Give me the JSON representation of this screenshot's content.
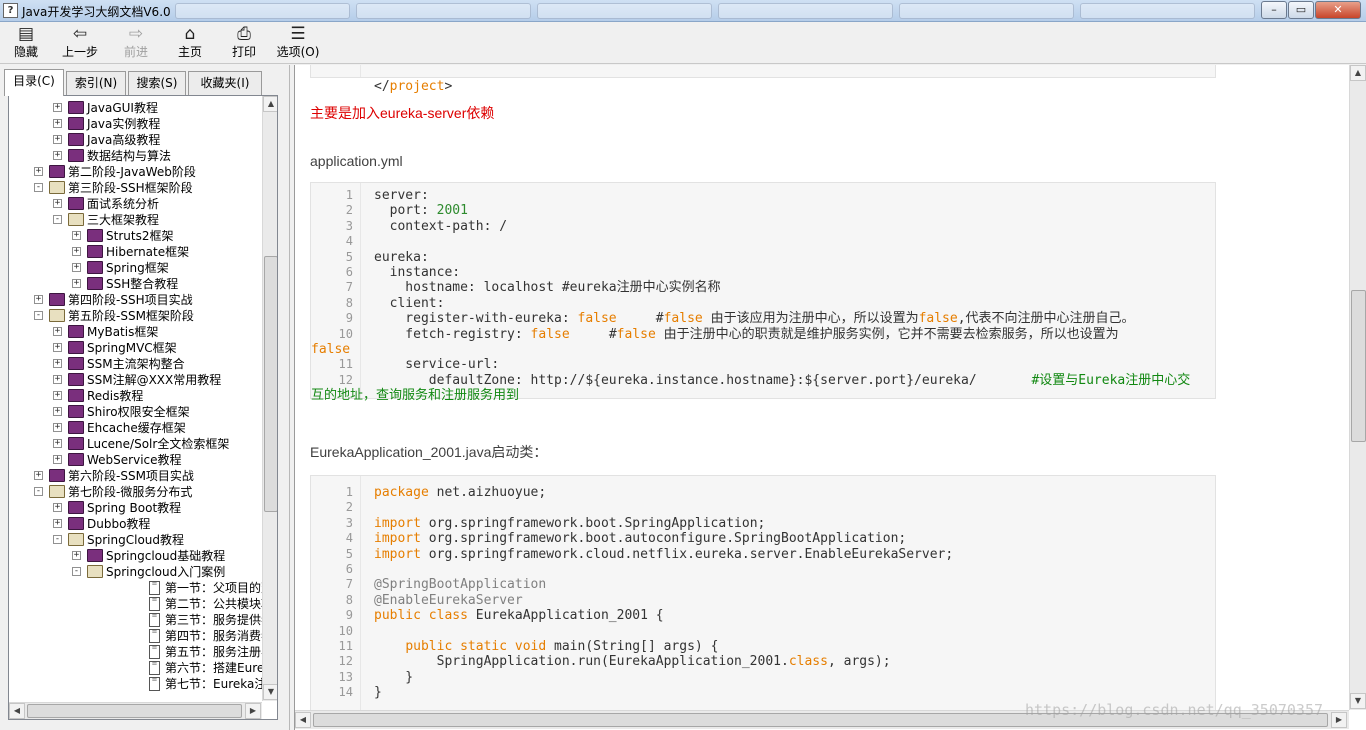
{
  "window": {
    "title": "Java开发学习大纲文档V6.0",
    "icon_char": "?",
    "buttons": [
      "minimize-icon",
      "maximize-icon",
      "close-icon"
    ]
  },
  "toolbar": [
    {
      "id": "hide",
      "label": "隐藏",
      "icon": "hide-icon",
      "glyph": "▤",
      "enabled": true
    },
    {
      "id": "back",
      "label": "上一步",
      "icon": "back-arrow-icon",
      "glyph": "⇦",
      "enabled": true
    },
    {
      "id": "forward",
      "label": "前进",
      "icon": "forward-arrow-icon",
      "glyph": "⇨",
      "enabled": false
    },
    {
      "id": "home",
      "label": "主页",
      "icon": "home-icon",
      "glyph": "⌂",
      "enabled": true
    },
    {
      "id": "print",
      "label": "打印",
      "icon": "printer-icon",
      "glyph": "⎙",
      "enabled": true
    },
    {
      "id": "options",
      "label": "选项(O)",
      "icon": "options-icon",
      "glyph": "☰",
      "enabled": true
    }
  ],
  "tabs": [
    {
      "label": "目录(C)",
      "active": true
    },
    {
      "label": "索引(N)",
      "active": false
    },
    {
      "label": "搜索(S)",
      "active": false
    },
    {
      "label": "收藏夹(I)",
      "active": false
    }
  ],
  "tree": [
    {
      "level": 1,
      "expander": "+",
      "icon": "book",
      "label": "JavaGUI教程"
    },
    {
      "level": 1,
      "expander": "+",
      "icon": "book",
      "label": "Java实例教程"
    },
    {
      "level": 1,
      "expander": "+",
      "icon": "book",
      "label": "Java高级教程"
    },
    {
      "level": 1,
      "expander": "+",
      "icon": "book",
      "label": "数据结构与算法"
    },
    {
      "level": 0,
      "expander": "+",
      "icon": "book",
      "label": "第二阶段-JavaWeb阶段"
    },
    {
      "level": 0,
      "expander": "-",
      "icon": "book-open",
      "label": "第三阶段-SSH框架阶段"
    },
    {
      "level": 1,
      "expander": "+",
      "icon": "book",
      "label": "面试系统分析"
    },
    {
      "level": 1,
      "expander": "-",
      "icon": "book-open",
      "label": "三大框架教程"
    },
    {
      "level": 2,
      "expander": "+",
      "icon": "book",
      "label": "Struts2框架"
    },
    {
      "level": 2,
      "expander": "+",
      "icon": "book",
      "label": "Hibernate框架"
    },
    {
      "level": 2,
      "expander": "+",
      "icon": "book",
      "label": "Spring框架"
    },
    {
      "level": 2,
      "expander": "+",
      "icon": "book",
      "label": "SSH整合教程"
    },
    {
      "level": 0,
      "expander": "+",
      "icon": "book",
      "label": "第四阶段-SSH项目实战"
    },
    {
      "level": 0,
      "expander": "-",
      "icon": "book-open",
      "label": "第五阶段-SSM框架阶段"
    },
    {
      "level": 1,
      "expander": "+",
      "icon": "book",
      "label": "MyBatis框架"
    },
    {
      "level": 1,
      "expander": "+",
      "icon": "book",
      "label": "SpringMVC框架"
    },
    {
      "level": 1,
      "expander": "+",
      "icon": "book",
      "label": "SSM主流架构整合"
    },
    {
      "level": 1,
      "expander": "+",
      "icon": "book",
      "label": "SSM注解@XXX常用教程"
    },
    {
      "level": 1,
      "expander": "+",
      "icon": "book",
      "label": "Redis教程"
    },
    {
      "level": 1,
      "expander": "+",
      "icon": "book",
      "label": "Shiro权限安全框架"
    },
    {
      "level": 1,
      "expander": "+",
      "icon": "book",
      "label": "Ehcache缓存框架"
    },
    {
      "level": 1,
      "expander": "+",
      "icon": "book",
      "label": "Lucene/Solr全文检索框架"
    },
    {
      "level": 1,
      "expander": "+",
      "icon": "book",
      "label": "WebService教程"
    },
    {
      "level": 0,
      "expander": "+",
      "icon": "book",
      "label": "第六阶段-SSM项目实战"
    },
    {
      "level": 0,
      "expander": "-",
      "icon": "book-open",
      "label": "第七阶段-微服务分布式"
    },
    {
      "level": 1,
      "expander": "+",
      "icon": "book",
      "label": "Spring Boot教程"
    },
    {
      "level": 1,
      "expander": "+",
      "icon": "book",
      "label": "Dubbo教程"
    },
    {
      "level": 1,
      "expander": "-",
      "icon": "book-open",
      "label": "SpringCloud教程"
    },
    {
      "level": 2,
      "expander": "+",
      "icon": "book",
      "label": "Springcloud基础教程"
    },
    {
      "level": 2,
      "expander": "-",
      "icon": "book-open",
      "label": "Springcloud入门案例"
    },
    {
      "level": 3,
      "expander": "",
      "icon": "page",
      "label": "第一节：父项目的建立"
    },
    {
      "level": 3,
      "expander": "",
      "icon": "page",
      "label": "第二节：公共模块项目搭建"
    },
    {
      "level": 3,
      "expander": "",
      "icon": "page",
      "label": "第三节：服务提供者项目建立"
    },
    {
      "level": 3,
      "expander": "",
      "icon": "page",
      "label": "第四节：服务消费者项目建立"
    },
    {
      "level": 3,
      "expander": "",
      "icon": "page",
      "label": "第五节：服务注册与发现组件"
    },
    {
      "level": 3,
      "expander": "",
      "icon": "page",
      "label": "第六节：搭建Eureka服务注册"
    },
    {
      "level": 3,
      "expander": "",
      "icon": "page",
      "label": "第七节：Eureka注册服务提供"
    }
  ],
  "content": {
    "top_code_line": "</project>",
    "heading_dependency": "主要是加入eureka-server依赖",
    "heading_yml": "application.yml",
    "yml_lines": [
      {
        "n": "1",
        "html": "server:"
      },
      {
        "n": "2",
        "html": "  port: <span class=\"num\">2001</span>"
      },
      {
        "n": "3",
        "html": "  context-path: /"
      },
      {
        "n": "4",
        "html": ""
      },
      {
        "n": "5",
        "html": "eureka:"
      },
      {
        "n": "6",
        "html": "  instance:"
      },
      {
        "n": "7",
        "html": "    hostname: localhost #eureka注册中心实例名称"
      },
      {
        "n": "8",
        "html": "  client:"
      },
      {
        "n": "9",
        "html": "    register-with-eureka: <span class=\"kw\">false</span>     #<span class=\"kw\">false</span> 由于该应用为注册中心，所以设置为<span class=\"kw\">false</span>,代表不向注册中心注册自己。"
      },
      {
        "n": "10",
        "html": "    fetch-registry: <span class=\"kw\">false</span>     #<span class=\"kw\">false</span> 由于注册中心的职责就是维护服务实例，它并不需要去检索服务，所以也设置为"
      },
      {
        "n": "",
        "html": "<span class=\"kw\" style=\"margin-left:-63px\">false</span>"
      },
      {
        "n": "11",
        "html": "    service-url:"
      },
      {
        "n": "12",
        "html": "       defaultZone: http://${eureka.instance.hostname}:${server.port}/eureka/       <span class=\"cm\">#设置与Eureka注册中心交</span>"
      },
      {
        "n": "",
        "html": "<span class=\"cm\" style=\"margin-left:-63px\">互的地址，查询服务和注册服务用到</span>"
      }
    ],
    "heading_java": "EurekaApplication_2001.java启动类：",
    "java_lines": [
      {
        "n": "1",
        "html": "<span class=\"kw\">package</span> net.aizhuoyue;"
      },
      {
        "n": "2",
        "html": ""
      },
      {
        "n": "3",
        "html": "<span class=\"kw\">import</span> org.springframework.boot.SpringApplication;"
      },
      {
        "n": "4",
        "html": "<span class=\"kw\">import</span> org.springframework.boot.autoconfigure.SpringBootApplication;"
      },
      {
        "n": "5",
        "html": "<span class=\"kw\">import</span> org.springframework.cloud.netflix.eureka.server.EnableEurekaServer;"
      },
      {
        "n": "6",
        "html": ""
      },
      {
        "n": "7",
        "html": "<span class=\"ann\">@SpringBootApplication</span>"
      },
      {
        "n": "8",
        "html": "<span class=\"ann\">@EnableEurekaServer</span>"
      },
      {
        "n": "9",
        "html": "<span class=\"kw\">public class</span> EurekaApplication_2001 {"
      },
      {
        "n": "10",
        "html": ""
      },
      {
        "n": "11",
        "html": "    <span class=\"kw\">public static void</span> main(String[] args) {"
      },
      {
        "n": "12",
        "html": "        SpringApplication.run(EurekaApplication_2001.<span class=\"kw\">class</span>, args);"
      },
      {
        "n": "13",
        "html": "    }"
      },
      {
        "n": "14",
        "html": "}"
      }
    ],
    "watermark": "https://blog.csdn.net/qq_35070357"
  }
}
